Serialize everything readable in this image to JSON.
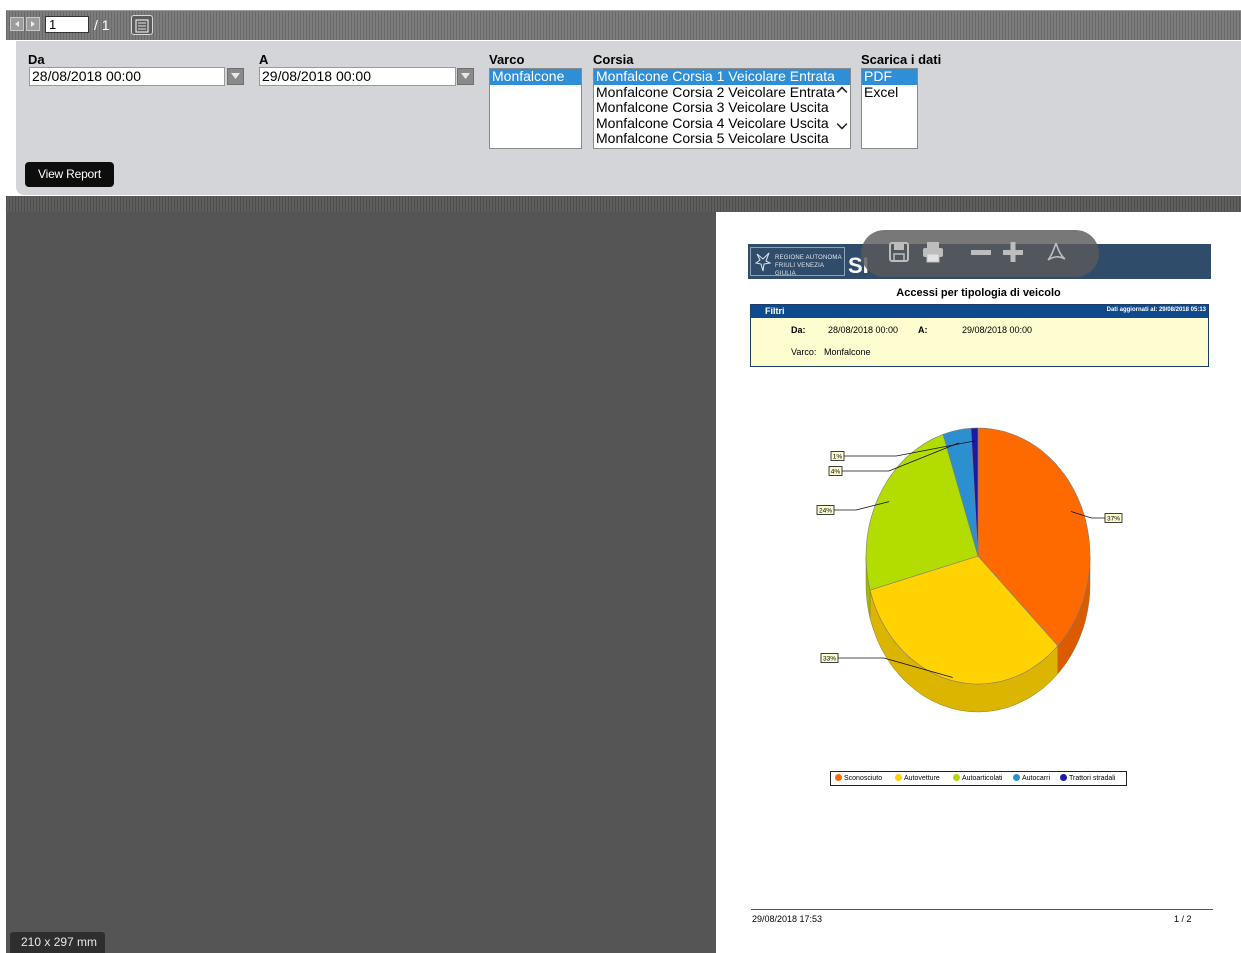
{
  "toolbar": {
    "page_current": "1",
    "page_total": "/ 1"
  },
  "params": {
    "da_label": "Da",
    "da_value": "28/08/2018 00:00",
    "a_label": "A",
    "a_value": "29/08/2018 00:00",
    "varco_label": "Varco",
    "varco_options": [
      "Monfalcone"
    ],
    "corsia_label": "Corsia",
    "corsia_options": [
      "Monfalcone Corsia 1 Veicolare Entrata",
      "Monfalcone Corsia 2 Veicolare Entrata",
      "Monfalcone Corsia 3 Veicolare Uscita",
      "Monfalcone Corsia 4 Veicolare Uscita",
      "Monfalcone Corsia 5 Veicolare Uscita"
    ],
    "scarica_label": "Scarica i dati",
    "scarica_options": [
      "PDF",
      "Excel"
    ],
    "view_report": "View Report"
  },
  "viewer": {
    "page_size": "210 x 297 mm"
  },
  "report": {
    "logo_line1": "REGIONE AUTONOMA",
    "logo_line2": "FRIULI VENEZIA GIULIA",
    "brand": "SI",
    "title": "Accessi per tipologia di veicolo",
    "filters_title": "Filtri",
    "updated": "Dati aggiornati al: 29/08/2018 05:13",
    "da_label": "Da:",
    "da_value": "28/08/2018 00:00",
    "a_label": "A:",
    "a_value": "29/08/2018 00:00",
    "varco_label": "Varco:",
    "varco_value": "Monfalcone",
    "footer_date": "29/08/2018 17:53",
    "footer_page": "1 / 2"
  },
  "chart_data": {
    "type": "pie",
    "title": "Accessi per tipologia di veicolo",
    "categories": [
      "Sconosciuto",
      "Autovetture",
      "Autoarticolati",
      "Autocarri",
      "Trattori stradali"
    ],
    "values": [
      37,
      33,
      24,
      4,
      1
    ],
    "labels": [
      "37%",
      "33%",
      "24%",
      "4%",
      "1%"
    ],
    "colors": [
      "#ff6a00",
      "#ffd200",
      "#b3dc00",
      "#2b8fd0",
      "#1c1aa8"
    ],
    "legend_position": "bottom"
  }
}
